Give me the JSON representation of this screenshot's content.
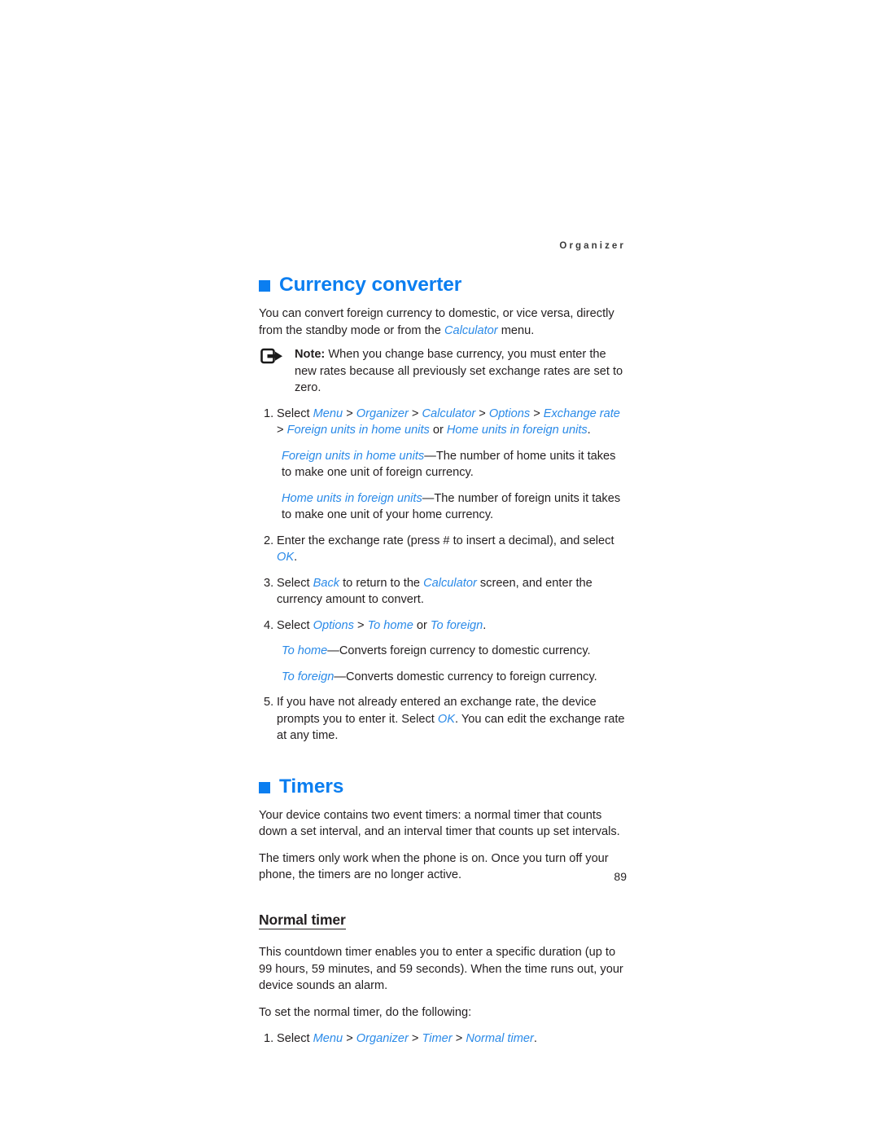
{
  "page": {
    "running_header": "Organizer",
    "folio": "89"
  },
  "sections": [
    {
      "id": "currency-converter",
      "heading": "Currency converter",
      "intro_lead": "You can convert foreign currency to domestic, or vice versa, directly from the standby mode or from the ",
      "intro_link": "Calculator",
      "intro_tail": " menu.",
      "note": {
        "icon": "note-arrow-icon",
        "label": "Note:",
        "text": " When you change base currency, you must enter the new rates because all previously set exchange rates are set to zero."
      },
      "steps": [
        {
          "num": "1.",
          "lead": "Select ",
          "path": [
            "Menu",
            "Organizer",
            "Calculator",
            "Options",
            "Exchange rate",
            "Foreign units in home units"
          ],
          "mid": " or ",
          "path2": [
            "Home units in foreign units"
          ],
          "tail": "."
        },
        {
          "num": "2.",
          "lead": "Enter the exchange rate (press # to insert a decimal), and select ",
          "link": "OK",
          "tail": "."
        },
        {
          "num": "3.",
          "lead": "Select ",
          "link": "Back",
          "mid": " to return to the ",
          "link2": "Calculator",
          "tail": " screen, and enter the currency amount to convert."
        },
        {
          "num": "4.",
          "lead": "Select ",
          "path": [
            "Options",
            "To home"
          ],
          "mid": " or ",
          "link2": "To foreign",
          "tail": "."
        },
        {
          "num": "5.",
          "lead": "If you have not already entered an exchange rate, the device prompts you to enter it. Select ",
          "link": "OK",
          "tail": ". You can edit the exchange rate at any time."
        }
      ],
      "definitions": [
        {
          "term": "Foreign units in home units",
          "desc": "—The number of home units it takes to make one unit of foreign currency."
        },
        {
          "term": "Home units in foreign units",
          "desc": "—The number of foreign units it takes to make one unit of your home currency."
        },
        {
          "term": "To home",
          "desc": "—Converts foreign currency to domestic currency."
        },
        {
          "term": "To foreign",
          "desc": "—Converts domestic currency to foreign currency."
        }
      ]
    },
    {
      "id": "timers",
      "heading": "Timers",
      "paragraphs": [
        "Your device contains two event timers: a normal timer that counts down a set interval, and an interval timer that counts up set intervals.",
        "The timers only work when the phone is on. Once you turn off your phone, the timers are no longer active."
      ],
      "subsection": {
        "heading": "Normal timer",
        "paragraphs": [
          " This countdown timer enables you to enter a specific duration (up to 99 hours, 59 minutes, and 59 seconds). When the time runs out, your device sounds an alarm.",
          "To set the normal timer, do the following:"
        ],
        "step": {
          "num": "1.",
          "lead": "Select ",
          "path": [
            "Menu",
            "Organizer",
            "Timer",
            "Normal timer"
          ],
          "tail": "."
        }
      }
    }
  ],
  "colors": {
    "accent_blue": "#0b7ef0",
    "inline_blue": "#2a8ae8",
    "body_text": "#231f20"
  }
}
